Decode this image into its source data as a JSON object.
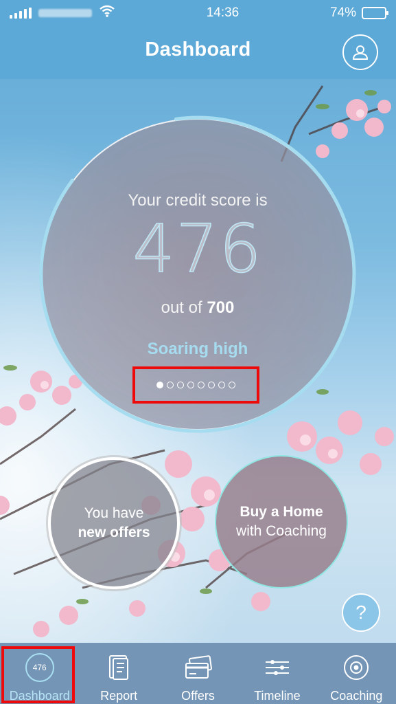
{
  "status_bar": {
    "time": "14:36",
    "battery_percent": "74%",
    "battery_level": 0.74
  },
  "header": {
    "title": "Dashboard",
    "profile_icon": "user-icon"
  },
  "score": {
    "caption": "Your credit score is",
    "value": "476",
    "out_of_prefix": "out of",
    "out_of_value": "700",
    "status": "Soaring high",
    "progress_fraction": 0.68,
    "pages_total": 8,
    "page_active": 1
  },
  "bubbles": {
    "offers": {
      "line1": "You have",
      "line2": "new offers"
    },
    "coaching": {
      "line1": "Buy a Home",
      "line2": "with Coaching"
    }
  },
  "help": {
    "label": "?"
  },
  "tabs": [
    {
      "label": "Dashboard",
      "icon": "score-badge-icon",
      "badge": "476",
      "active": true
    },
    {
      "label": "Report",
      "icon": "document-icon",
      "active": false
    },
    {
      "label": "Offers",
      "icon": "credit-card-icon",
      "active": false
    },
    {
      "label": "Timeline",
      "icon": "timeline-icon",
      "active": false
    },
    {
      "label": "Coaching",
      "icon": "target-icon",
      "active": false
    }
  ],
  "colors": {
    "header_blue": "#5ca8d6",
    "accent_cyan": "#a6dcef",
    "tab_bar": "#7495b5",
    "highlight_red": "#ee0a0a"
  }
}
